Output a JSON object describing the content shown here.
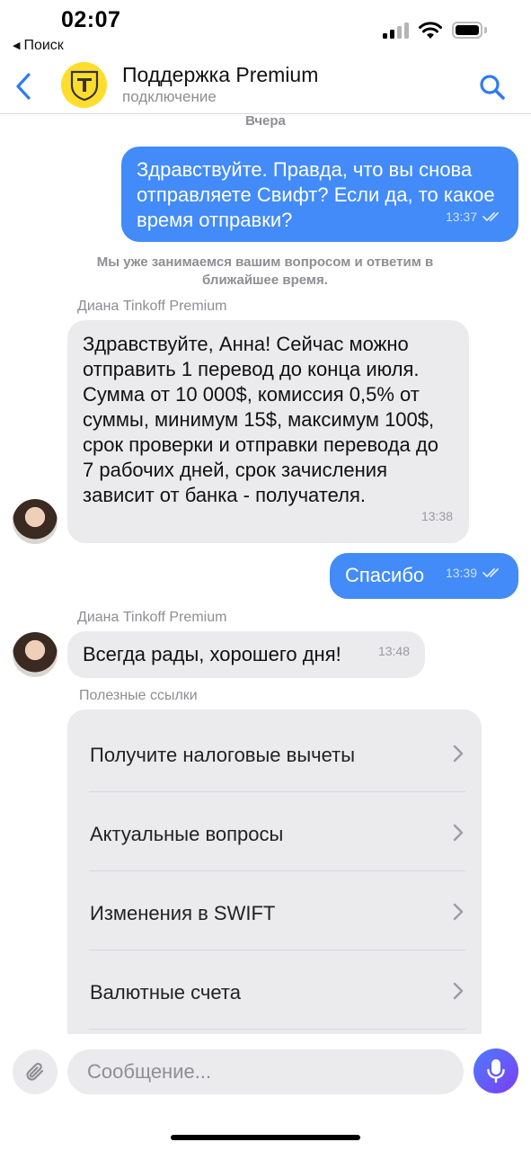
{
  "status_bar": {
    "time": "02:07",
    "back_app": "Поиск"
  },
  "header": {
    "title": "Поддержка Premium",
    "subtitle": "подключение"
  },
  "chat": {
    "date_separator": "Вчера",
    "messages": [
      {
        "direction": "out",
        "text": "Здравствуйте. Правда, что вы снова отправляете Свифт? Если да, то какое время отправки?",
        "time": "13:37",
        "status": "read"
      },
      {
        "direction": "system",
        "text": "Мы уже занимаемся вашим вопросом и ответим в ближайшее время."
      },
      {
        "direction": "in",
        "sender": "Диана Tinkoff Premium",
        "text": "Здравствуйте, Анна! Сейчас можно отправить 1 перевод до конца июля. Сумма от 10 000$, комиссия 0,5% от суммы, минимум 15$, максимум 100$, срок проверки и отправки перевода до 7 рабочих дней, срок зачисления зависит от банка - получателя.",
        "time": "13:38"
      },
      {
        "direction": "out",
        "text": "Спасибо",
        "time": "13:39",
        "status": "read"
      },
      {
        "direction": "in",
        "sender": "Диана Tinkoff Premium",
        "text": "Всегда рады, хорошего дня!",
        "time": "13:48"
      }
    ]
  },
  "useful_links": {
    "title": "Полезные ссылки",
    "items": [
      {
        "label": "Получите налоговые вычеты"
      },
      {
        "label": "Актуальные вопросы"
      },
      {
        "label": "Изменения в SWIFT"
      },
      {
        "label": "Валютные счета"
      }
    ]
  },
  "composer": {
    "placeholder": "Сообщение..."
  },
  "colors": {
    "accent": "#428bf9",
    "incoming_bubble": "#ebebee",
    "logo_yellow": "#ffdd2d",
    "mic_gradient": [
      "#4d7cff",
      "#7b3df5"
    ]
  },
  "icons": [
    "back-arrow",
    "search",
    "attach-paperclip",
    "microphone",
    "chevron-right",
    "double-check"
  ]
}
